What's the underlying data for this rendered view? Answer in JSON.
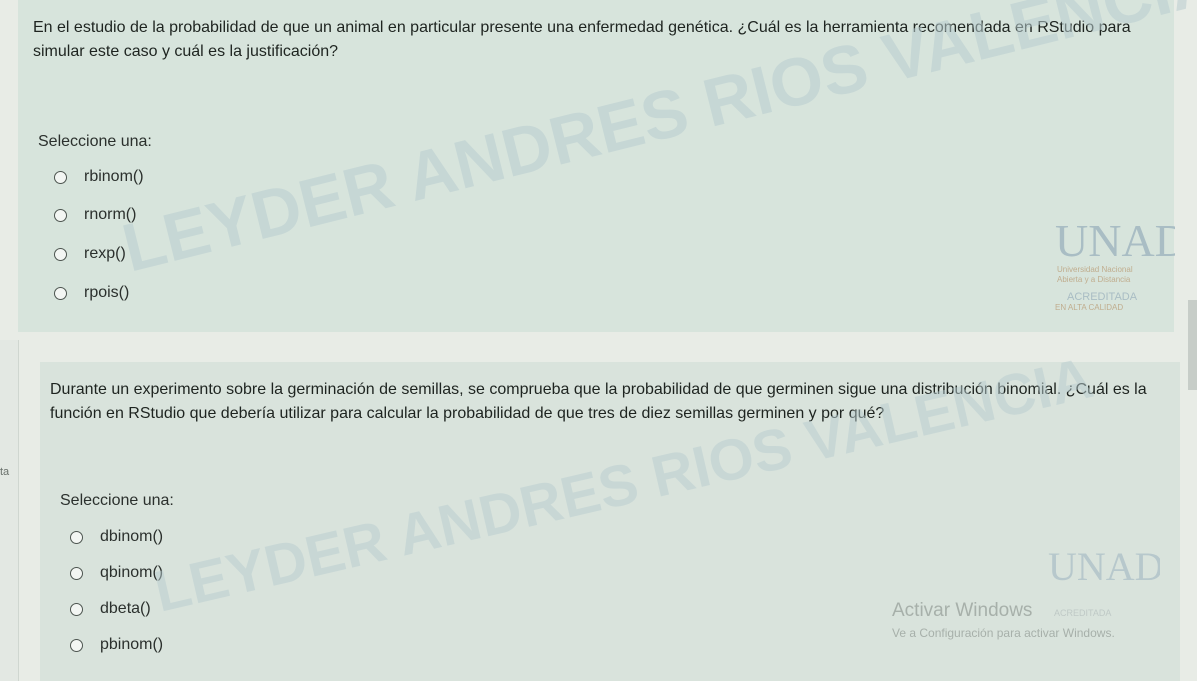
{
  "question1": {
    "text": "En el estudio de la probabilidad de que un animal en particular presente una enfermedad genética. ¿Cuál es la herramienta recomendada en RStudio para simular este caso y cuál es la justificación?",
    "prompt": "Seleccione una:",
    "options": [
      "rbinom()",
      "rnorm()",
      "rexp()",
      "rpois()"
    ]
  },
  "question2": {
    "text": "Durante un experimento sobre la germinación de semillas, se comprueba que la probabilidad de que germinen sigue una distribución binomial. ¿Cuál es la función en RStudio que debería utilizar para calcular la probabilidad de que tres de diez semillas germinen y por qué?",
    "prompt": "Seleccione una:",
    "options": [
      "dbinom()",
      "qbinom()",
      "dbeta()",
      "pbinom()"
    ]
  },
  "watermark": {
    "name": "LEYDER ANDRES RIOS VALENCIA",
    "color": "#b9cdd0"
  },
  "logo": {
    "brand": "UNAD",
    "line1": "Universidad Nacional",
    "line2": "Abierta y a Distancia",
    "badge": "ACREDITADA",
    "badge_sub": "EN ALTA CALIDAD",
    "accent": "#e0a24a"
  },
  "side_fragment": "ta",
  "activate_windows": {
    "title": "Activar Windows",
    "subtitle": "Ve a Configuración para activar Windows."
  }
}
